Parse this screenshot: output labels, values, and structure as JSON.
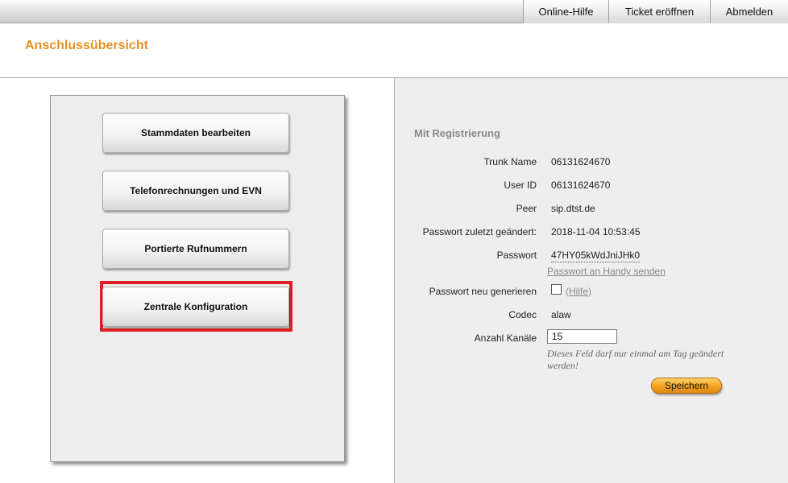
{
  "nav": {
    "help": "Online-Hilfe",
    "ticket": "Ticket eröffnen",
    "logout": "Abmelden"
  },
  "header": {
    "title": "Anschlussübersicht"
  },
  "menu": {
    "items": [
      "Stammdaten bearbeiten",
      "Telefonrechnungen und EVN",
      "Portierte Rufnummern",
      "Zentrale Konfiguration"
    ],
    "highlighted_index": 3
  },
  "details": {
    "section_title": "Mit Registrierung",
    "trunk_name_label": "Trunk Name",
    "trunk_name": "06131624670",
    "user_id_label": "User ID",
    "user_id": "06131624670",
    "peer_label": "Peer",
    "peer": "sip.dtst.de",
    "pw_changed_label": "Passwort zuletzt geändert:",
    "pw_changed": "2018-11-04 10:53:45",
    "password_label": "Passwort",
    "password": "47HY05kWdJniJHk0",
    "send_sms_link": "Passwort an Handy senden",
    "regenerate_label": "Passwort neu generieren",
    "help_open": "(",
    "help_link": "Hilfe",
    "help_close": ")",
    "codec_label": "Codec",
    "codec": "alaw",
    "channels_label": "Anzahl Kanäle",
    "channels": "15",
    "channels_note": "Dieses Feld darf nur einmal am Tag geändert werden!",
    "save_label": "Speichern"
  },
  "colors": {
    "title_orange": "#e8901f",
    "highlight_red": "#e01e24",
    "save_orange": "#f5a623"
  }
}
